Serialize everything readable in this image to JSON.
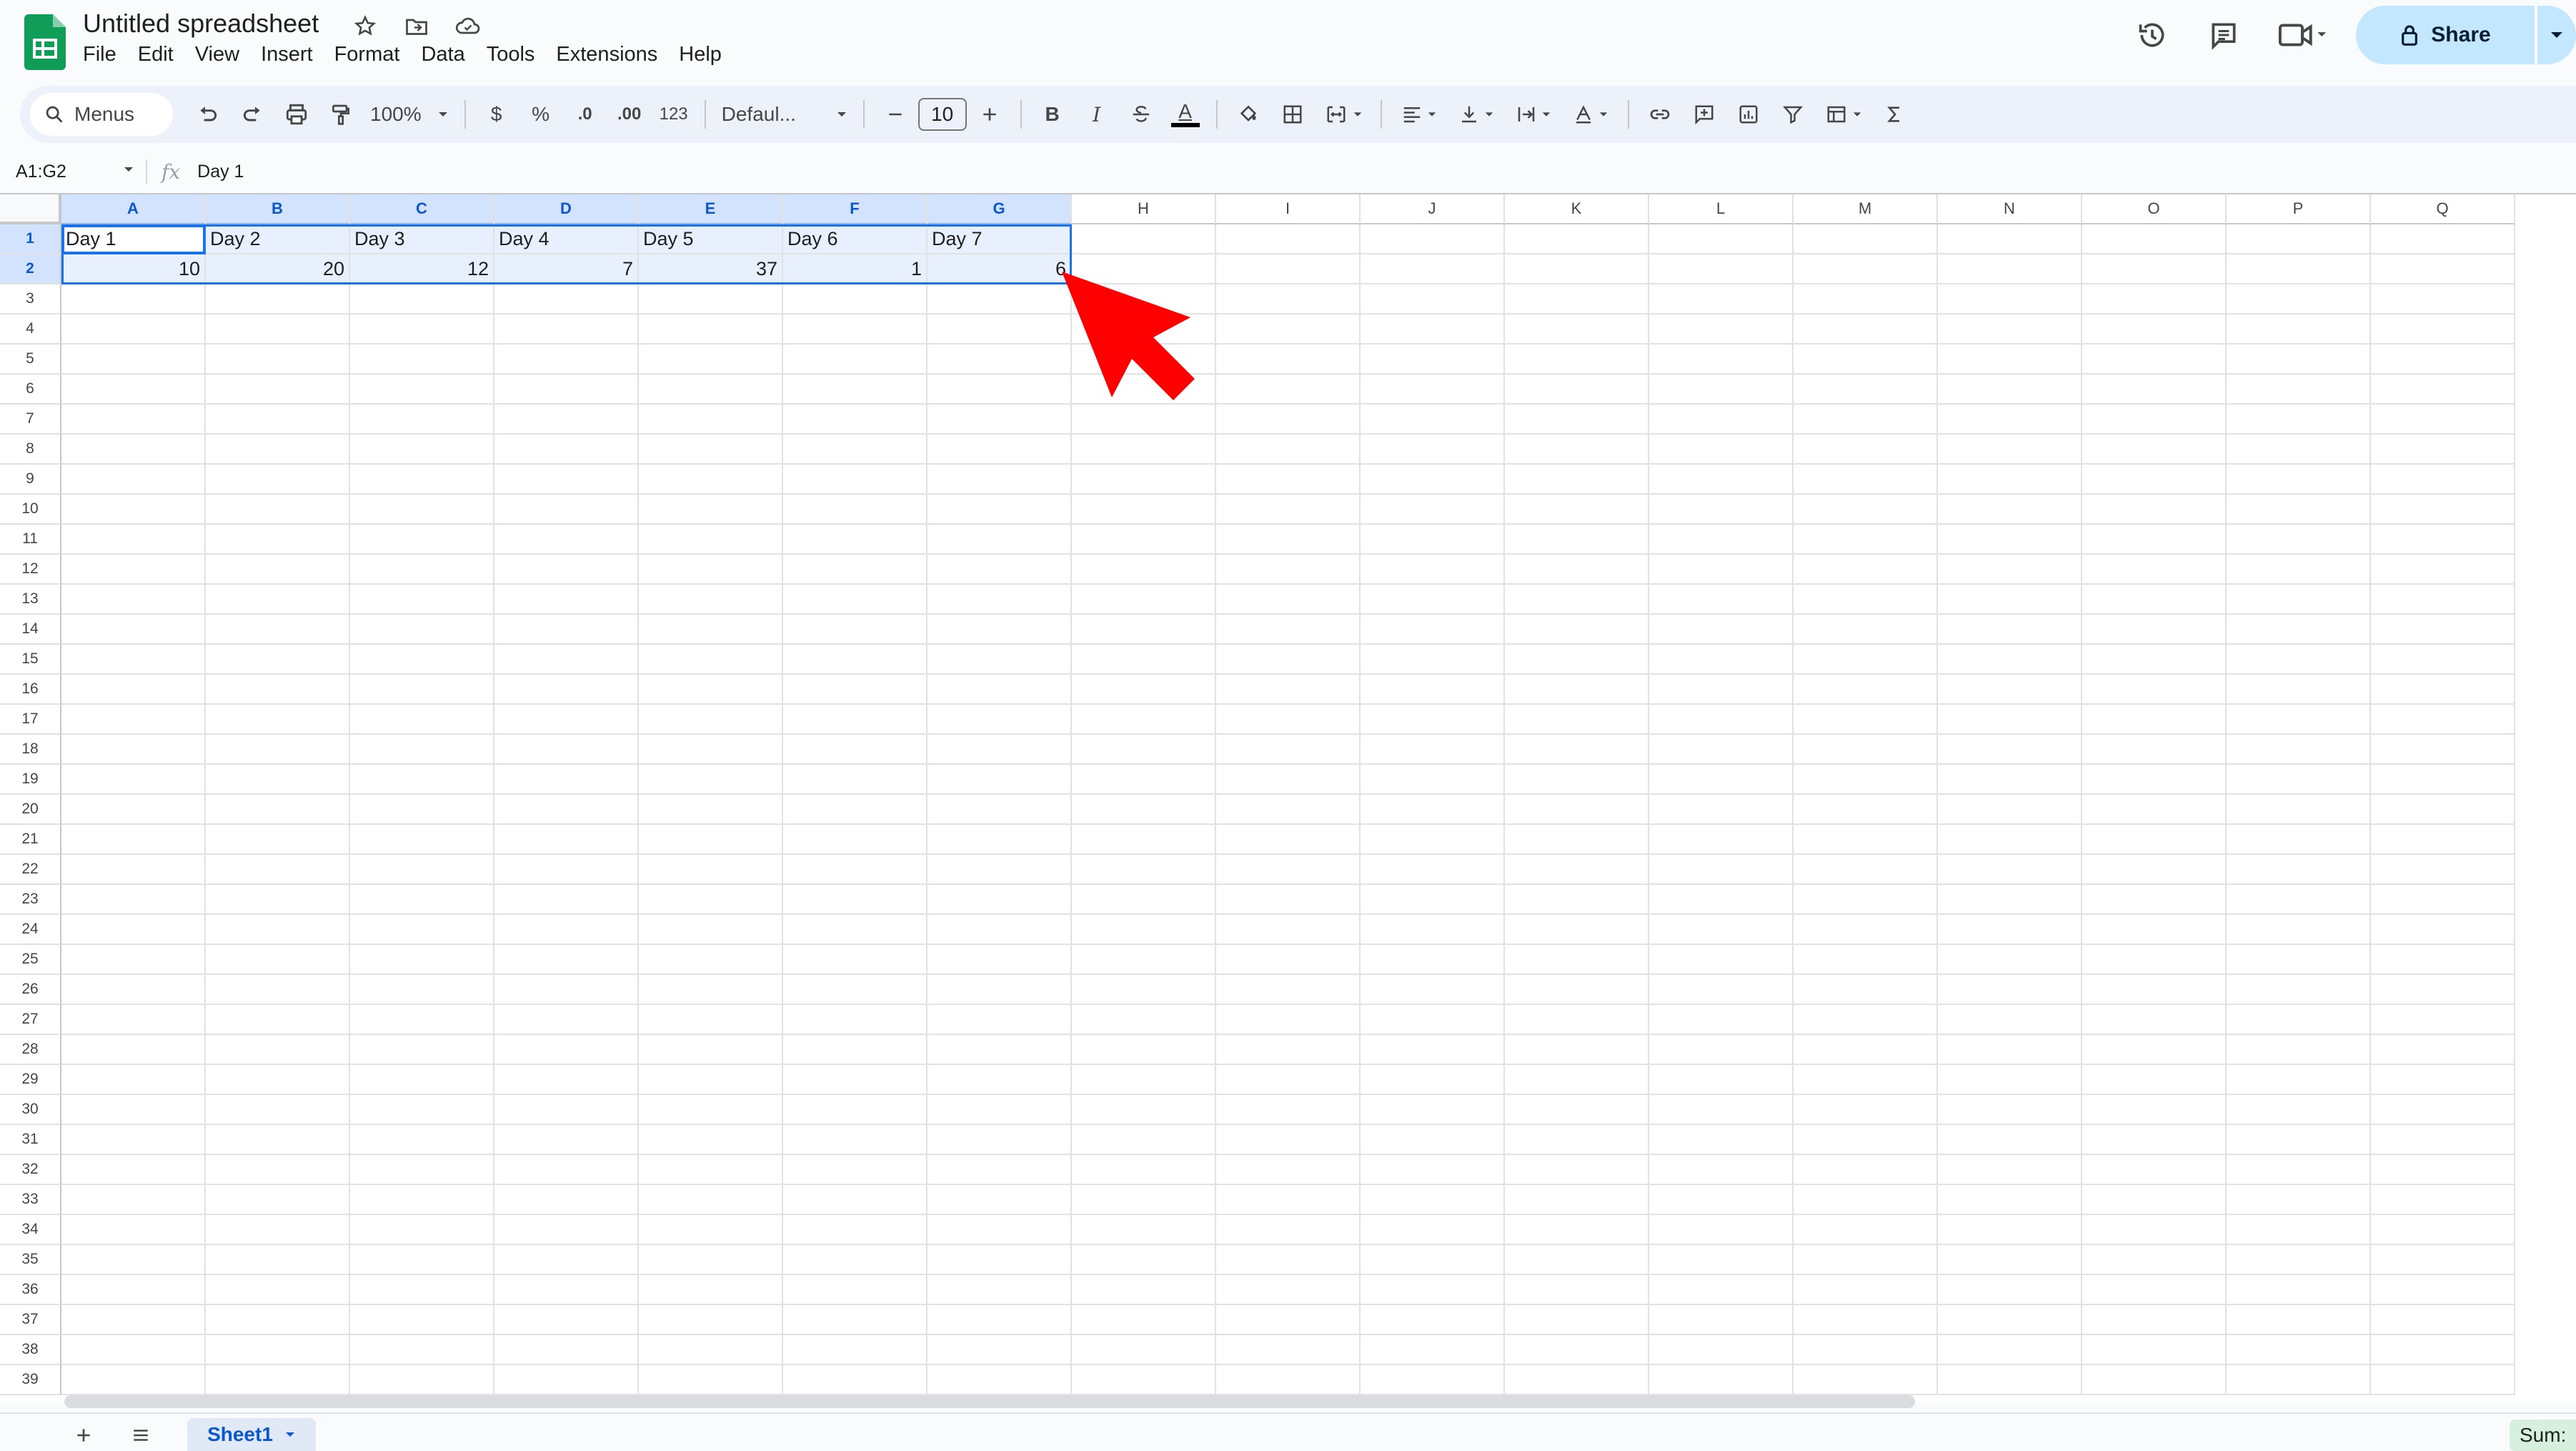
{
  "document": {
    "title": "Untitled spreadsheet",
    "menu": [
      "File",
      "Edit",
      "View",
      "Insert",
      "Format",
      "Data",
      "Tools",
      "Extensions",
      "Help"
    ],
    "share_label": "Share"
  },
  "toolbar": {
    "search_label": "Menus",
    "zoom": "100%",
    "currency": "$",
    "percent": "%",
    "decrease_decimal": ".0",
    "increase_decimal": ".00",
    "number_format": "123",
    "font_family": "Defaul...",
    "font_size": "10",
    "bold": "B",
    "italic": "I",
    "text_color": "A"
  },
  "formula_bar": {
    "name_box": "A1:G2",
    "fx": "fx",
    "value": "Day 1"
  },
  "grid": {
    "columns": [
      "A",
      "B",
      "C",
      "D",
      "E",
      "F",
      "G",
      "H",
      "I",
      "J",
      "K",
      "L",
      "M",
      "N",
      "O",
      "P",
      "Q"
    ],
    "rows": [
      "1",
      "2",
      "3",
      "4",
      "5",
      "6",
      "7",
      "8",
      "9",
      "10",
      "11",
      "12",
      "13",
      "14",
      "15",
      "16",
      "17",
      "18",
      "19",
      "20",
      "21",
      "22",
      "23",
      "24",
      "25",
      "26",
      "27",
      "28",
      "29",
      "30",
      "31",
      "32",
      "33",
      "34",
      "35",
      "36",
      "37",
      "38",
      "39"
    ],
    "row1": [
      "Day 1",
      "Day 2",
      "Day 3",
      "Day 4",
      "Day 5",
      "Day 6",
      "Day 7"
    ],
    "row2": [
      "10",
      "20",
      "12",
      "7",
      "37",
      "1",
      "6"
    ],
    "selected_range": "A1:G2"
  },
  "bottom_bar": {
    "sheet_name": "Sheet1",
    "sum_label": "Sum:"
  },
  "colors": {
    "accent": "#1a73e8",
    "share_bg": "#c2e7ff",
    "selection": "#d3e3fd",
    "cursor": "#ff0000"
  }
}
